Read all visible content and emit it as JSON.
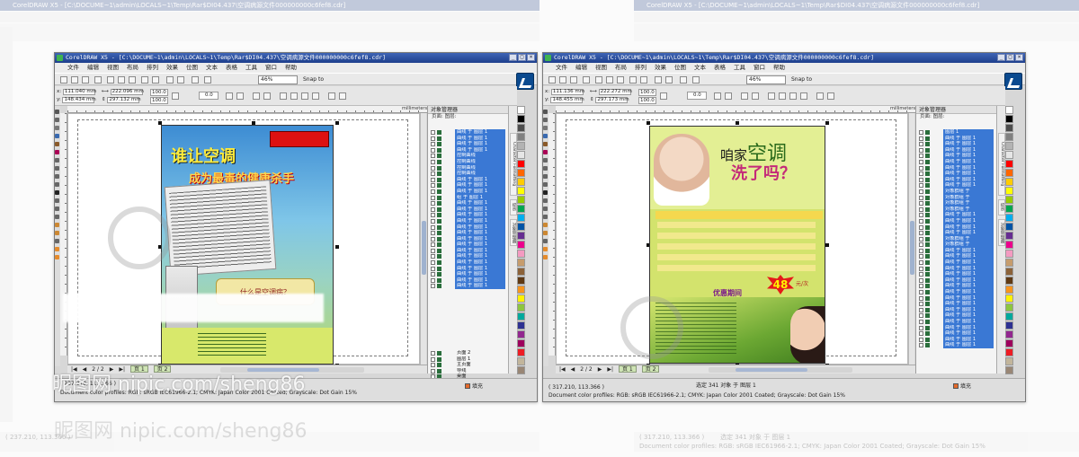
{
  "screens": [
    {
      "title": "CorelDRAW X5 - [C:\\DOCUME~1\\admin\\LOCALS~1\\Temp\\Rar$DI04.437\\空调病源文件000000000c6fef8.cdr]",
      "menu": [
        "文件",
        "编辑",
        "视图",
        "布局",
        "排列",
        "效果",
        "位图",
        "文本",
        "表格",
        "工具",
        "窗口",
        "帮助"
      ],
      "zoom": "46%",
      "snap_to": "Snap to",
      "x_label": "x:",
      "y_label": "y:",
      "x": "111.040 mm",
      "y": "148.434 mm",
      "w": "222.096 mm",
      "h": "297.132 mm",
      "scale_w": "100.0",
      "scale_h": "100.0",
      "rotation": "0.0",
      "units": "millimeters",
      "object_manager": {
        "header": "对象管理器",
        "page": "页面: 图层:",
        "rows": [
          "曲线 于 图层 1",
          "曲线 于 图层 1",
          "曲线 于 图层 1",
          "曲线 于 图层 1",
          "控制曲线",
          "控制曲线",
          "控制曲线",
          "控制曲线",
          "曲线 于 图层 1",
          "曲线 于 图层 1",
          "曲线 于 图层 1",
          "组 于 图层 1",
          "曲线 于 图层 1",
          "曲线 于 图层 1",
          "曲线 于 图层 1",
          "曲线 于 图层 1",
          "曲线 于 图层 1",
          "曲线 于 图层 1",
          "曲线 于 图层 1",
          "曲线 于 图层 1",
          "曲线 于 图层 1",
          "曲线 于 图层 1",
          "曲线 于 图层 1",
          "曲线 于 图层 1",
          "曲线 于 图层 1",
          "曲线 于 图层 1",
          "曲线 于 图层 1"
        ],
        "lower_rows": [
          "页面 2",
          "图层 1",
          "主页面",
          "导线",
          "桌面",
          "网格"
        ]
      },
      "dock_tabs": [
        "Character Formatting",
        "提示",
        "对象管理器"
      ],
      "page_counter": "2 / 2",
      "page_tabs": [
        "页 1",
        "页 2"
      ],
      "status_coords": "( 237.210, 113.366 )",
      "status_profiles": "Document color profiles: RGB: sRGB IEC61966-2.1; CMYK: Japan Color 2001 Coated; Grayscale: Dot Gain 15%",
      "fill_label": "填充",
      "poster": {
        "headline_1": "谁让空调",
        "headline_2": "成为最毒的健康杀手",
        "caption": "什么是空调病？"
      }
    },
    {
      "title": "CorelDRAW X5 - [C:\\DOCUME~1\\admin\\LOCALS~1\\Temp\\Rar$DI04.437\\空调病源文件000000000c6fef8.cdr]",
      "menu": [
        "文件",
        "编辑",
        "视图",
        "布局",
        "排列",
        "效果",
        "位图",
        "文本",
        "表格",
        "工具",
        "窗口",
        "帮助"
      ],
      "zoom": "46%",
      "snap_to": "Snap to",
      "x_label": "x:",
      "y_label": "y:",
      "x": "111.136 mm",
      "y": "148.455 mm",
      "w": "222.272 mm",
      "h": "297.173 mm",
      "scale_w": "100.0",
      "scale_h": "100.0",
      "rotation": "0.0",
      "units": "millimeters",
      "object_manager": {
        "header": "对象管理器",
        "page": "页面: 图层:",
        "rows": [
          "图层 1",
          "曲线 于 图层 1",
          "曲线 于 图层 1",
          "曲线 于 图层 1",
          "曲线 于 图层 1",
          "曲线 于 图层 1",
          "曲线 于 图层 1",
          "曲线 于 图层 1",
          "曲线 于 图层 1",
          "曲线 于 图层 1",
          "对象群组 于",
          "对象群组 于",
          "对象群组 于",
          "对象群组 于",
          "曲线 于 图层 1",
          "曲线 于 图层 1",
          "曲线 于 图层 1",
          "曲线 于 图层 1",
          "对象群组 于",
          "对象群组 于",
          "曲线 于 图层 1",
          "曲线 于 图层 1",
          "曲线 于 图层 1",
          "曲线 于 图层 1",
          "曲线 于 图层 1",
          "曲线 于 图层 1",
          "曲线 于 图层 1",
          "曲线 于 图层 1",
          "曲线 于 图层 1",
          "曲线 于 图层 1",
          "曲线 于 图层 1",
          "曲线 于 图层 1",
          "曲线 于 图层 1",
          "曲线 于 图层 1",
          "曲线 于 图层 1",
          "曲线 于 图层 1",
          "曲线 于 图层 1"
        ]
      },
      "dock_tabs": [
        "Character Formatting",
        "提示",
        "对象管理器"
      ],
      "page_counter": "2 / 2",
      "page_tabs": [
        "页 1",
        "页 2"
      ],
      "status_selection": "选定 341 对象 于 图层 1",
      "status_coords": "( 317.210, 113.366 )",
      "status_profiles": "Document color profiles: RGB: sRGB IEC61966-2.1; CMYK: Japan Color 2001 Coated; Grayscale: Dot Gain 15%",
      "fill_label": "填充",
      "poster": {
        "headline_1": "咱家",
        "headline_1_big": "空调",
        "headline_2": "洗了吗？",
        "price": "48",
        "price_unit": "元/次",
        "promo": "优惠期间"
      }
    }
  ],
  "watermark": {
    "text": "昵图网 nipic.com/",
    "user": "sheng86",
    "ghost_text": "昵图网 nipic.com/",
    "ghost_user": "sheng86"
  },
  "ghost": {
    "left_title": "CorelDRAW X5 - [C:\\DOCUME~1\\admin\\LOCALS~1\\Temp\\Rar$DI04.437\\空调病源文件000000000c6fef8.cdr]",
    "right_title": "CorelDRAW X5 - [C:\\DOCUME~1\\admin\\LOCALS~1\\Temp\\Rar$DI04.437\\空调病源文件000000000c6fef8.cdr]",
    "left_status": "( 237.210, 113.366 )",
    "right_status": "( 317.210, 113.366 )",
    "right_status_selection": "选定 341 对象 于 图层 1",
    "profiles": "Document color profiles: RGB: sRGB IEC61966-2.1; CMYK: Japan Color 2001 Coated; Grayscale: Dot Gain 15%"
  },
  "colors": {
    "title_bar": "#1d3f8c",
    "selection": "#3a78d4",
    "accent": "#0b4a8f"
  }
}
